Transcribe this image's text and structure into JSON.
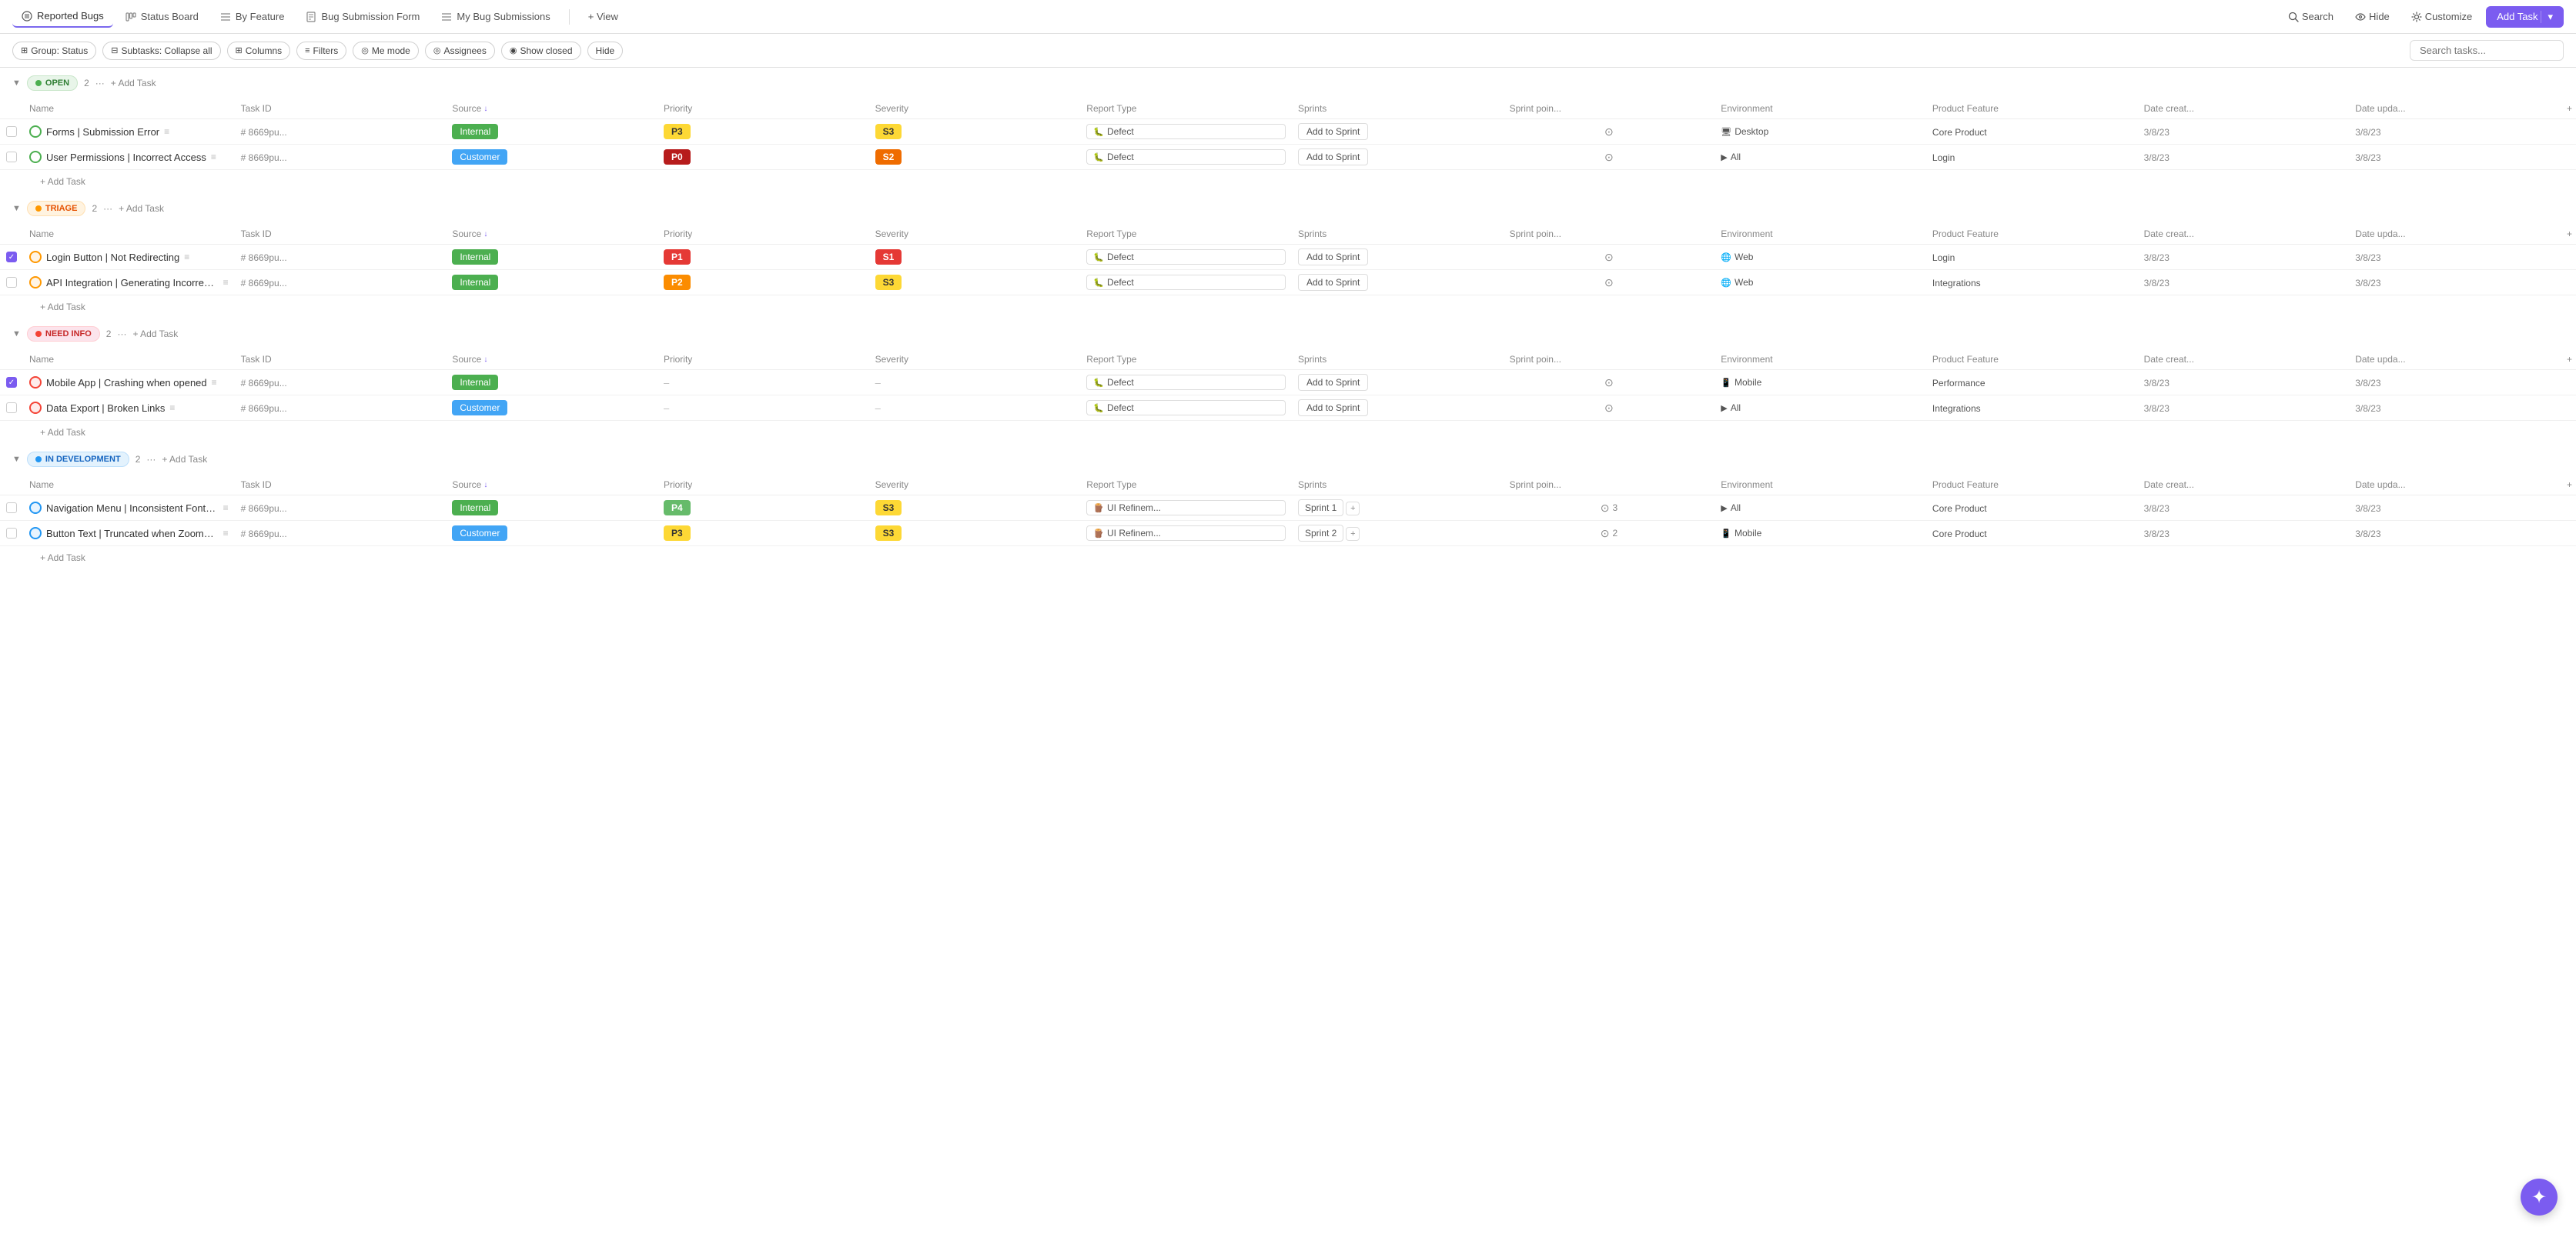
{
  "nav": {
    "tabs": [
      {
        "id": "reported-bugs",
        "label": "Reported Bugs",
        "active": true
      },
      {
        "id": "status-board",
        "label": "Status Board",
        "active": false
      },
      {
        "id": "by-feature",
        "label": "By Feature",
        "active": false
      },
      {
        "id": "bug-submission-form",
        "label": "Bug Submission Form",
        "active": false
      },
      {
        "id": "my-bug-submissions",
        "label": "My Bug Submissions",
        "active": false
      },
      {
        "id": "view",
        "label": "+ View",
        "active": false
      }
    ],
    "search_label": "Search",
    "hide_label": "Hide",
    "customize_label": "Customize",
    "add_task_label": "Add Task"
  },
  "filters": {
    "group": "Group: Status",
    "subtasks": "Subtasks: Collapse all",
    "columns": "Columns",
    "filters": "Filters",
    "me_mode": "Me mode",
    "assignees": "Assignees",
    "show_closed": "Show closed",
    "hide": "Hide",
    "search_placeholder": "Search tasks..."
  },
  "columns": {
    "name": "Name",
    "task_id": "Task ID",
    "source": "Source",
    "priority": "Priority",
    "severity": "Severity",
    "report_type": "Report Type",
    "sprints": "Sprints",
    "sprint_points": "Sprint poin...",
    "environment": "Environment",
    "product_feature": "Product Feature",
    "date_created": "Date creat...",
    "date_updated": "Date upda..."
  },
  "sections": [
    {
      "id": "open",
      "label": "OPEN",
      "badge_class": "badge-open",
      "dot_class": "dot-open",
      "count": 2,
      "tasks": [
        {
          "name": "Forms | Submission Error",
          "task_id": "# 8669pu...",
          "source": "Internal",
          "source_class": "source-internal",
          "priority": "P3",
          "priority_class": "priority-p3",
          "severity": "S3",
          "severity_class": "severity-s3",
          "report_type": "Defect",
          "report_type_icon": "defect",
          "sprint": "Add to Sprint",
          "sprint_points": "",
          "environment": "Desktop",
          "environment_icon": "desktop",
          "product_feature": "Core Product",
          "date_created": "3/8/23",
          "date_updated": "3/8/23",
          "status_class": "task-status-open",
          "checked": false
        },
        {
          "name": "User Permissions | Incorrect Access",
          "task_id": "# 8669pu...",
          "source": "Customer",
          "source_class": "source-customer",
          "priority": "P0",
          "priority_class": "priority-p0",
          "severity": "S2",
          "severity_class": "severity-s2",
          "report_type": "Defect",
          "report_type_icon": "defect",
          "sprint": "Add to Sprint",
          "sprint_points": "",
          "environment": "All",
          "environment_icon": "play",
          "product_feature": "Login",
          "date_created": "3/8/23",
          "date_updated": "3/8/23",
          "status_class": "task-status-open",
          "checked": false
        }
      ]
    },
    {
      "id": "triage",
      "label": "TRIAGE",
      "badge_class": "badge-triage",
      "dot_class": "dot-triage",
      "count": 2,
      "tasks": [
        {
          "name": "Login Button | Not Redirecting",
          "task_id": "# 8669pu...",
          "source": "Internal",
          "source_class": "source-internal",
          "priority": "P1",
          "priority_class": "priority-p1",
          "severity": "S1",
          "severity_class": "severity-s1",
          "report_type": "Defect",
          "report_type_icon": "defect",
          "sprint": "Add to Sprint",
          "sprint_points": "",
          "environment": "Web",
          "environment_icon": "web",
          "product_feature": "Login",
          "date_created": "3/8/23",
          "date_updated": "3/8/23",
          "status_class": "task-status-triage",
          "checked": true
        },
        {
          "name": "API Integration | Generating Incorrect ...",
          "task_id": "# 8669pu...",
          "source": "Internal",
          "source_class": "source-internal",
          "priority": "P2",
          "priority_class": "priority-p2",
          "severity": "S3",
          "severity_class": "severity-s3",
          "report_type": "Defect",
          "report_type_icon": "defect",
          "sprint": "Add to Sprint",
          "sprint_points": "",
          "environment": "Web",
          "environment_icon": "web",
          "product_feature": "Integrations",
          "date_created": "3/8/23",
          "date_updated": "3/8/23",
          "status_class": "task-status-triage",
          "checked": false
        }
      ]
    },
    {
      "id": "needinfo",
      "label": "NEED INFO",
      "badge_class": "badge-needinfo",
      "dot_class": "dot-needinfo",
      "count": 2,
      "tasks": [
        {
          "name": "Mobile App | Crashing when opened",
          "task_id": "# 8669pu...",
          "source": "Internal",
          "source_class": "source-internal",
          "priority": "–",
          "priority_class": "",
          "severity": "–",
          "severity_class": "",
          "report_type": "Defect",
          "report_type_icon": "defect",
          "sprint": "Add to Sprint",
          "sprint_points": "",
          "environment": "Mobile",
          "environment_icon": "mobile",
          "product_feature": "Performance",
          "date_created": "3/8/23",
          "date_updated": "3/8/23",
          "status_class": "task-status-needinfo",
          "checked": true
        },
        {
          "name": "Data Export | Broken Links",
          "task_id": "# 8669pu...",
          "source": "Customer",
          "source_class": "source-customer",
          "priority": "–",
          "priority_class": "",
          "severity": "–",
          "severity_class": "",
          "report_type": "Defect",
          "report_type_icon": "defect",
          "sprint": "Add to Sprint",
          "sprint_points": "",
          "environment": "All",
          "environment_icon": "play",
          "product_feature": "Integrations",
          "date_created": "3/8/23",
          "date_updated": "3/8/23",
          "status_class": "task-status-needinfo",
          "checked": false
        }
      ]
    },
    {
      "id": "indev",
      "label": "IN DEVELOPMENT",
      "badge_class": "badge-indev",
      "dot_class": "dot-indev",
      "count": 2,
      "tasks": [
        {
          "name": "Navigation Menu | Inconsistent Font Si...",
          "task_id": "# 8669pu...",
          "source": "Internal",
          "source_class": "source-internal",
          "priority": "P4",
          "priority_class": "priority-p4",
          "severity": "S3",
          "severity_class": "severity-s3",
          "report_type": "UI Refinem...",
          "report_type_icon": "ui",
          "sprint": "Sprint 1",
          "sprint_plus": true,
          "sprint_points": "3",
          "environment": "All",
          "environment_icon": "play",
          "product_feature": "Core Product",
          "date_created": "3/8/23",
          "date_updated": "3/8/23",
          "status_class": "task-status-indev",
          "checked": false
        },
        {
          "name": "Button Text | Truncated when Zoomed...",
          "task_id": "# 8669pu...",
          "source": "Customer",
          "source_class": "source-customer",
          "priority": "P3",
          "priority_class": "priority-p3",
          "severity": "S3",
          "severity_class": "severity-s3",
          "report_type": "UI Refinem...",
          "report_type_icon": "ui",
          "sprint": "Sprint 2",
          "sprint_plus": true,
          "sprint_points": "2",
          "environment": "Mobile",
          "environment_icon": "mobile",
          "product_feature": "Core Product",
          "date_created": "3/8/23",
          "date_updated": "3/8/23",
          "status_class": "task-status-indev",
          "checked": false
        }
      ]
    }
  ],
  "add_task_label": "+ Add Task",
  "add_row_label": "+ Add Task"
}
